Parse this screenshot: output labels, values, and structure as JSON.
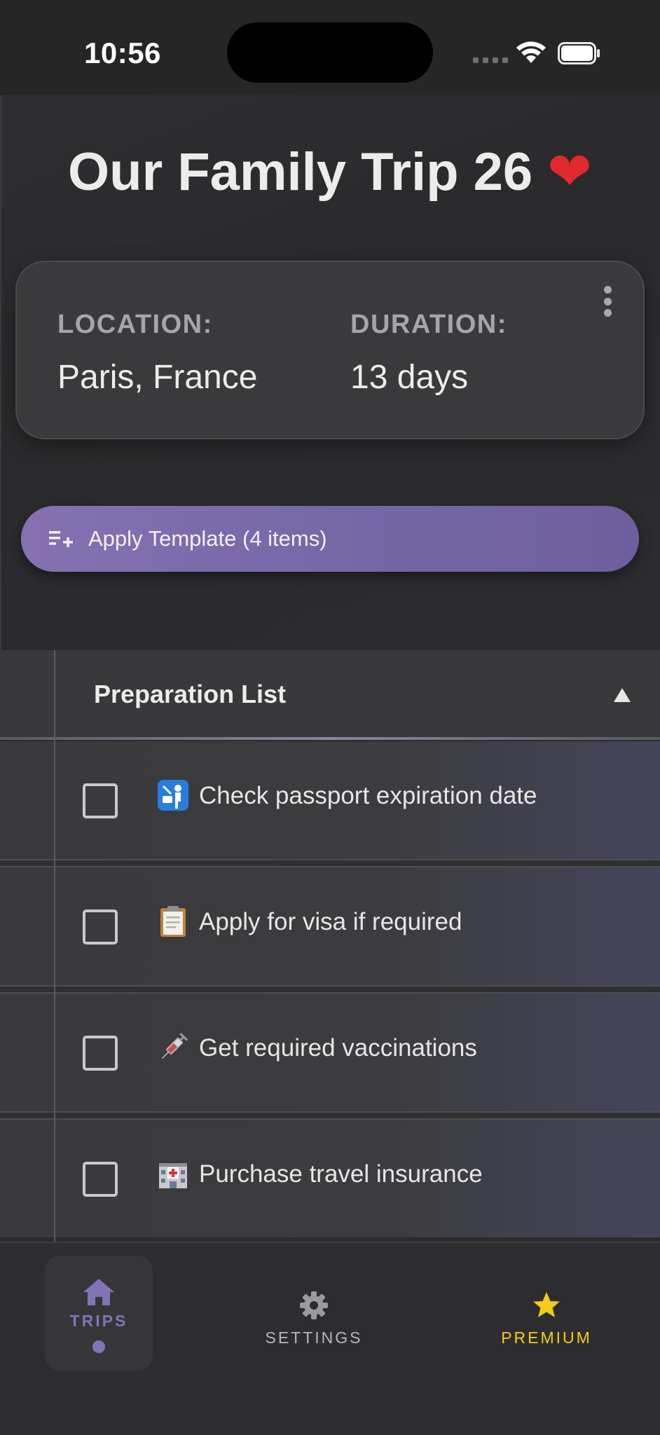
{
  "status_bar": {
    "time": "10:56"
  },
  "trip": {
    "title": "Our Family Trip 26",
    "title_emoji": "❤️"
  },
  "info_card": {
    "location_label": "LOCATION:",
    "location_value": "Paris, France",
    "duration_label": "DURATION:",
    "duration_value": "13 days"
  },
  "template_button": {
    "label": "Apply Template (4 items)"
  },
  "preparation_list": {
    "title": "Preparation List",
    "items": [
      {
        "emoji": "passport-control-icon",
        "label": "Check passport expiration date",
        "checked": false
      },
      {
        "emoji": "clipboard-icon",
        "label": "Apply for visa if required",
        "checked": false
      },
      {
        "emoji": "syringe-icon",
        "label": "Get required vaccinations",
        "checked": false
      },
      {
        "emoji": "hospital-icon",
        "label": "Purchase travel insurance",
        "checked": false
      }
    ]
  },
  "bottom_nav": {
    "trips": "TRIPS",
    "settings": "SETTINGS",
    "premium": "PREMIUM",
    "active": "trips"
  },
  "colors": {
    "accent": "#8273b4",
    "premium": "#f2cd19",
    "heart": "#e0282f"
  }
}
